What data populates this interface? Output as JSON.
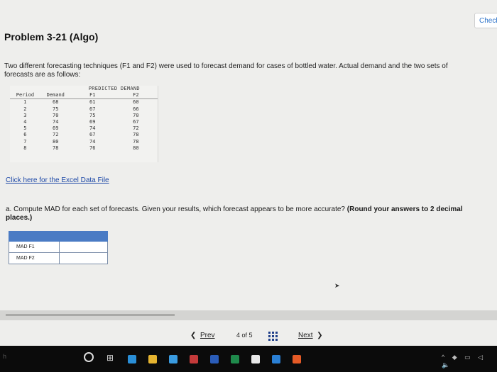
{
  "header": {
    "check_label": "Check"
  },
  "problem": {
    "title": "Problem 3-21 (Algo)",
    "description": "Two different forecasting techniques (F1 and F2) were used to forecast demand for cases of bottled water. Actual demand and the two sets of forecasts are as follows:"
  },
  "forecast_table": {
    "group_header": "PREDICTED DEMAND",
    "columns": [
      "Period",
      "Demand",
      "F1",
      "F2"
    ],
    "rows": [
      [
        "1",
        "68",
        "61",
        "60"
      ],
      [
        "2",
        "75",
        "67",
        "66"
      ],
      [
        "3",
        "70",
        "75",
        "70"
      ],
      [
        "4",
        "74",
        "69",
        "67"
      ],
      [
        "5",
        "69",
        "74",
        "72"
      ],
      [
        "6",
        "72",
        "67",
        "78"
      ],
      [
        "7",
        "80",
        "74",
        "78"
      ],
      [
        "8",
        "78",
        "76",
        "80"
      ]
    ]
  },
  "excel_link": "Click here for the Excel Data File",
  "question": {
    "text": "a. Compute MAD for each set of forecasts. Given your results, which forecast appears to be more accurate?",
    "hint": "(Round your answers to 2 decimal places.)"
  },
  "answer_table": {
    "rows": [
      {
        "label": "MAD F1",
        "value": ""
      },
      {
        "label": "MAD F2",
        "value": ""
      }
    ]
  },
  "pager": {
    "prev_label": "Prev",
    "count": "4 of 5",
    "next_label": "Next"
  },
  "taskbar": {
    "left_mark": "h",
    "tray_text": "^ ◆ ▭ ◁ 🔈",
    "icons": [
      {
        "name": "edge-icon",
        "color": "#2a8fd8"
      },
      {
        "name": "files-icon",
        "color": "#e6b430"
      },
      {
        "name": "photos-icon",
        "color": "#3a9be0"
      },
      {
        "name": "red-app-icon",
        "color": "#c43a3a"
      },
      {
        "name": "word-icon",
        "color": "#2a5cb8"
      },
      {
        "name": "excel-icon",
        "color": "#1f8a4c"
      },
      {
        "name": "store-icon",
        "color": "#e8e8e8"
      },
      {
        "name": "mail-icon",
        "color": "#2a7fd4"
      },
      {
        "name": "firefox-icon",
        "color": "#e55a26"
      }
    ]
  },
  "colors": {
    "answer_header": "#4a7bc4",
    "link": "#1f4aa8",
    "background": "#eeeeec"
  }
}
